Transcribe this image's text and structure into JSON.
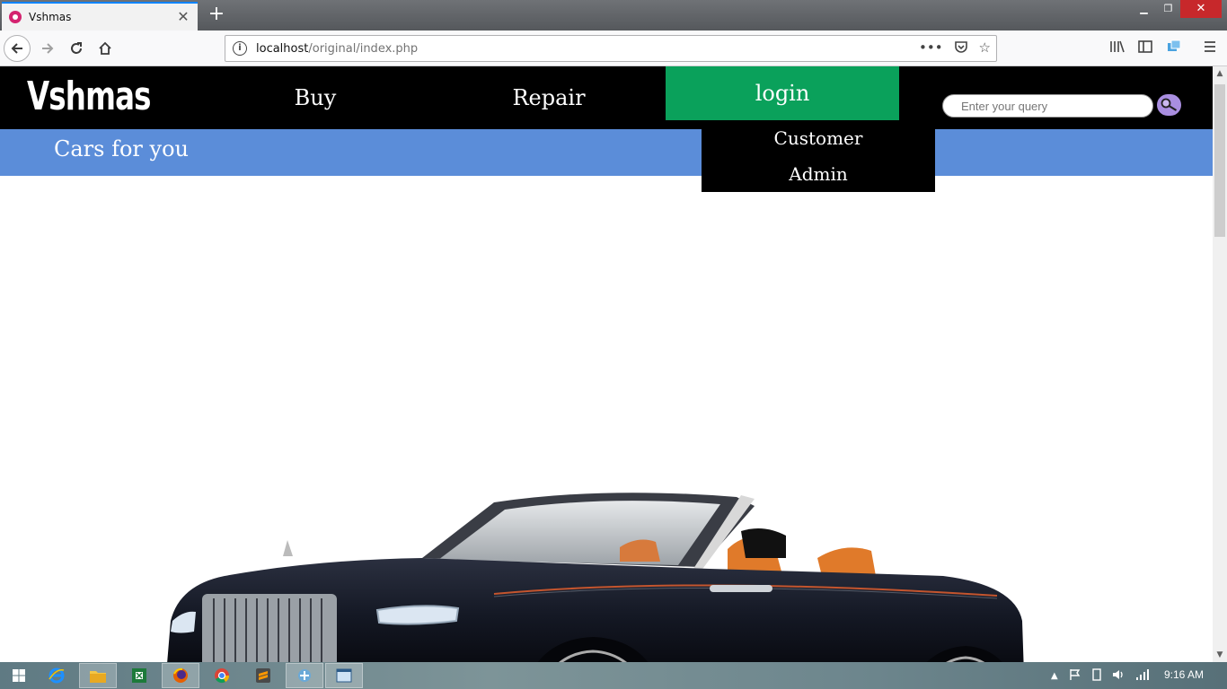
{
  "browser": {
    "tab_title": "Vshmas",
    "url_host": "localhost",
    "url_path": "/original/index.php"
  },
  "site": {
    "brand": "Vshmas",
    "nav": [
      {
        "label": "Buy"
      },
      {
        "label": "Repair"
      },
      {
        "label": "login",
        "active": true
      }
    ],
    "dropdown": [
      "Customer",
      "Admin"
    ],
    "search_placeholder": "Enter your query",
    "tagline": "Cars for you",
    "colors": {
      "header": "#000000",
      "active": "#0aa15b",
      "subbar": "#5b8dd9",
      "search_button": "#a98ee0"
    }
  },
  "taskbar": {
    "clock": "9:16 AM",
    "icons": [
      "windows-icon",
      "ie-icon",
      "file-explorer-icon",
      "excel-icon",
      "firefox-icon",
      "chrome-icon",
      "sublime-icon",
      "app-icon",
      "window-icon"
    ]
  }
}
